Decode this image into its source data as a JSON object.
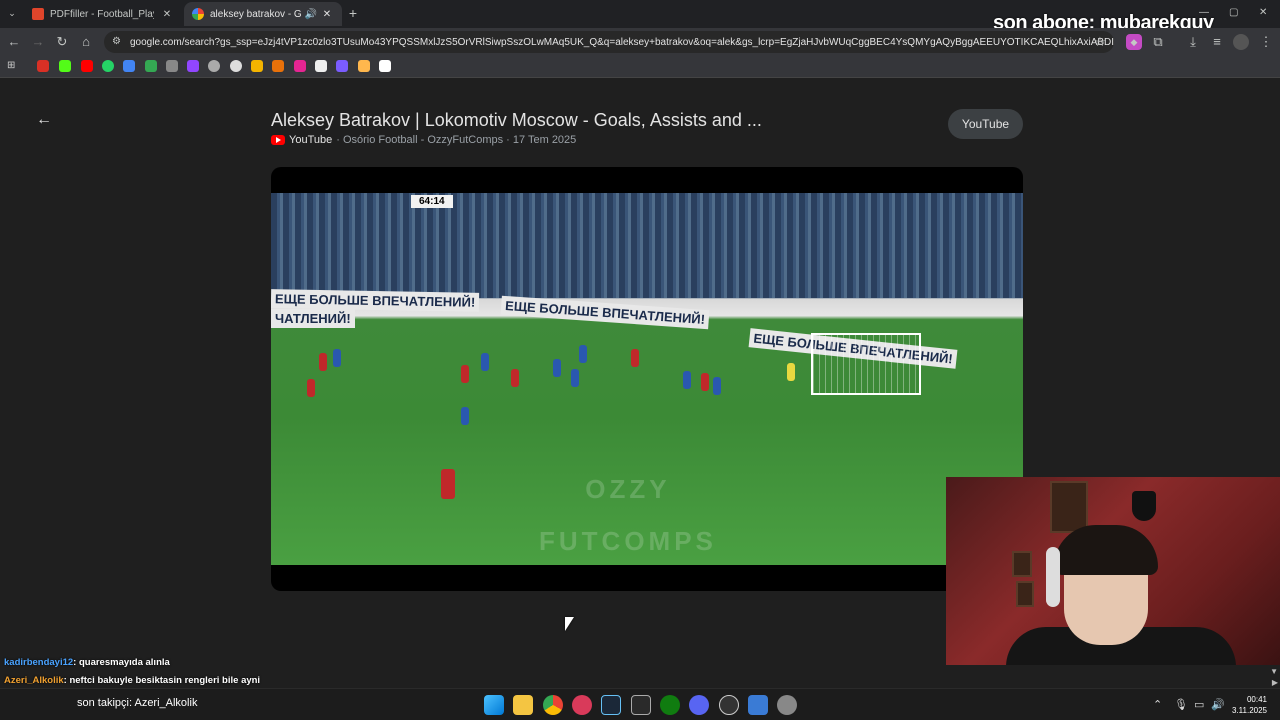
{
  "browser": {
    "tabs": [
      {
        "label": "PDFfiller - Football_Players_Stat",
        "active": false
      },
      {
        "label": "aleksey batrakov - Google'da",
        "active": true
      }
    ],
    "new_tab": "+",
    "url": "google.com/search?gs_ssp=eJzj4tVP1zc0zlo3TUsuMo43YPQSSMxlJzS5OrVRlSiwpSszOLwMAq5UK_Q&q=aleksey+batrakov&oq=alek&gs_lcrp=EgZjaHJvbWUqCggBEC4YsQMYgAQyBggAEEUYOTIKCAEQLhixAxiABDISCAIQLhhDGMcB...",
    "bookmark_count": 14
  },
  "overlay": {
    "text": "son abone: mubarekguy"
  },
  "result": {
    "title": "Aleksey Batrakov | Lokomotiv Moscow - Goals, Assists and ...",
    "source": "YouTube",
    "meta": "· Osório Football - OzzyFutComps · 17 Tem 2025",
    "button": "YouTube"
  },
  "video": {
    "scoreboard": "64:14",
    "banner_text": "ЕЩЕ БОЛЬШЕ ВПЕЧАТЛЕНИЙ!",
    "banner_text_2": "ЧАТЛЕНИЙ!",
    "watermark_1": "OZZY",
    "watermark_2": "FUTCOMPS"
  },
  "chat": [
    {
      "user": "kadirbendayi12",
      "message": ": quaresmayıda alınla",
      "color": "#4aa3ff"
    },
    {
      "user": "Azeri_Alkolik",
      "message": ": neftci bakuyle besiktasin rengleri bile ayni",
      "color": "#f0a030"
    }
  ],
  "taskbar": {
    "follower": "son takipçi: Azeri_Alkolik",
    "time": "00:41",
    "date": "3.11.2025"
  }
}
